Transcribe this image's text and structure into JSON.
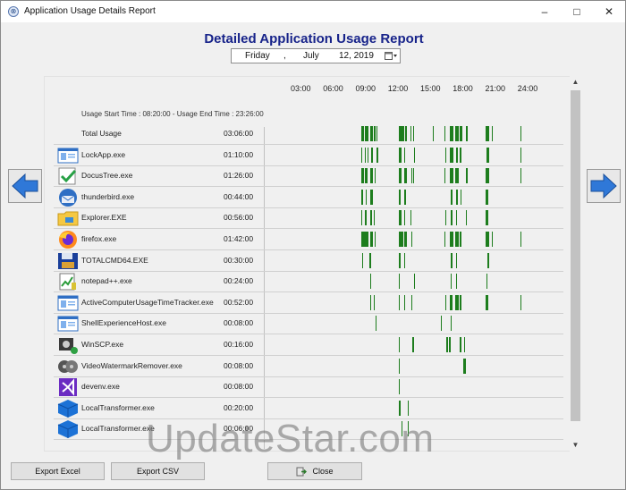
{
  "window": {
    "title": "Application Usage Details Report"
  },
  "report": {
    "title": "Detailed Application Usage Report",
    "date": {
      "weekday": "Friday",
      "sep": ",",
      "month": "July",
      "dayyear": "12, 2019"
    },
    "hours": [
      "03:00",
      "06:00",
      "09:00",
      "12:00",
      "15:00",
      "18:00",
      "21:00",
      "24:00"
    ],
    "usage_range": "Usage Start Time : 08:20:00 - Usage End Time : 23:26:00"
  },
  "colors": {
    "usage_bar": "#1d7d1d",
    "title": "#17238a",
    "nav_arrow": "#2f78d8"
  },
  "rows": [
    {
      "name": "Total Usage",
      "duration": "03:06:00",
      "icon": "none",
      "usage": [
        [
          8.6,
          0.25
        ],
        [
          8.95,
          0.3
        ],
        [
          9.4,
          0.3
        ],
        [
          9.75,
          0.15
        ],
        [
          10.0,
          0.1
        ],
        [
          12.05,
          0.5
        ],
        [
          12.65,
          0.2
        ],
        [
          13.15,
          0.1
        ],
        [
          13.4,
          0.1
        ],
        [
          15.2,
          0.15
        ],
        [
          16.3,
          0.1
        ],
        [
          16.8,
          0.35
        ],
        [
          17.3,
          0.3
        ],
        [
          17.75,
          0.2
        ],
        [
          18.3,
          0.15
        ],
        [
          20.1,
          0.35
        ],
        [
          20.7,
          0.1
        ],
        [
          23.3,
          0.1
        ]
      ]
    },
    {
      "name": "LockApp.exe",
      "duration": "01:10:00",
      "icon": "app-window-icon",
      "usage": [
        [
          8.6,
          0.1
        ],
        [
          8.95,
          0.1
        ],
        [
          9.2,
          0.1
        ],
        [
          9.55,
          0.1
        ],
        [
          10.05,
          0.1
        ],
        [
          12.05,
          0.3
        ],
        [
          12.55,
          0.1
        ],
        [
          13.45,
          0.1
        ],
        [
          16.35,
          0.1
        ],
        [
          16.8,
          0.3
        ],
        [
          17.35,
          0.2
        ],
        [
          17.75,
          0.1
        ],
        [
          20.2,
          0.25
        ],
        [
          23.3,
          0.1
        ]
      ]
    },
    {
      "name": "DocusTree.exe",
      "duration": "01:26:00",
      "icon": "checkmark-icon",
      "usage": [
        [
          8.6,
          0.25
        ],
        [
          8.95,
          0.2
        ],
        [
          9.4,
          0.3
        ],
        [
          9.85,
          0.1
        ],
        [
          12.05,
          0.3
        ],
        [
          12.6,
          0.2
        ],
        [
          13.2,
          0.1
        ],
        [
          13.4,
          0.1
        ],
        [
          16.3,
          0.1
        ],
        [
          16.8,
          0.3
        ],
        [
          17.3,
          0.3
        ],
        [
          18.3,
          0.15
        ],
        [
          20.1,
          0.3
        ],
        [
          23.3,
          0.1
        ]
      ]
    },
    {
      "name": "thunderbird.exe",
      "duration": "00:44:00",
      "icon": "thunderbird-icon",
      "usage": [
        [
          8.6,
          0.15
        ],
        [
          9.0,
          0.1
        ],
        [
          9.45,
          0.2
        ],
        [
          12.05,
          0.2
        ],
        [
          12.6,
          0.15
        ],
        [
          16.85,
          0.2
        ],
        [
          17.35,
          0.2
        ],
        [
          17.8,
          0.1
        ],
        [
          20.15,
          0.2
        ]
      ]
    },
    {
      "name": "Explorer.EXE",
      "duration": "00:56:00",
      "icon": "folder-icon",
      "usage": [
        [
          8.6,
          0.1
        ],
        [
          8.95,
          0.15
        ],
        [
          9.4,
          0.2
        ],
        [
          9.75,
          0.1
        ],
        [
          12.05,
          0.3
        ],
        [
          12.55,
          0.15
        ],
        [
          13.15,
          0.1
        ],
        [
          16.35,
          0.1
        ],
        [
          16.85,
          0.2
        ],
        [
          17.35,
          0.15
        ],
        [
          18.3,
          0.1
        ],
        [
          20.15,
          0.2
        ]
      ]
    },
    {
      "name": "firefox.exe",
      "duration": "01:42:00",
      "icon": "firefox-icon",
      "usage": [
        [
          8.6,
          0.3
        ],
        [
          8.95,
          0.35
        ],
        [
          9.4,
          0.3
        ],
        [
          9.85,
          0.1
        ],
        [
          12.05,
          0.45
        ],
        [
          12.6,
          0.2
        ],
        [
          13.2,
          0.1
        ],
        [
          16.3,
          0.1
        ],
        [
          16.8,
          0.35
        ],
        [
          17.3,
          0.3
        ],
        [
          17.75,
          0.15
        ],
        [
          20.1,
          0.35
        ],
        [
          20.7,
          0.1
        ],
        [
          23.3,
          0.1
        ]
      ]
    },
    {
      "name": "TOTALCMD64.EXE",
      "duration": "00:30:00",
      "icon": "floppy-disk-icon",
      "usage": [
        [
          8.7,
          0.1
        ],
        [
          9.35,
          0.15
        ],
        [
          12.1,
          0.15
        ],
        [
          12.55,
          0.1
        ],
        [
          16.9,
          0.15
        ],
        [
          17.35,
          0.1
        ],
        [
          20.25,
          0.15
        ]
      ]
    },
    {
      "name": "notepad++.exe",
      "duration": "00:24:00",
      "icon": "notepad-icon",
      "usage": [
        [
          9.4,
          0.1
        ],
        [
          12.05,
          0.1
        ],
        [
          13.45,
          0.1
        ],
        [
          16.9,
          0.1
        ],
        [
          17.4,
          0.1
        ],
        [
          20.2,
          0.1
        ]
      ]
    },
    {
      "name": "ActiveComputerUsageTimeTracker.exe",
      "duration": "00:52:00",
      "icon": "app-window-icon",
      "usage": [
        [
          9.4,
          0.15
        ],
        [
          9.75,
          0.1
        ],
        [
          12.05,
          0.15
        ],
        [
          12.55,
          0.1
        ],
        [
          13.2,
          0.1
        ],
        [
          16.35,
          0.1
        ],
        [
          16.8,
          0.25
        ],
        [
          17.3,
          0.3
        ],
        [
          17.75,
          0.1
        ],
        [
          20.15,
          0.25
        ],
        [
          23.3,
          0.1
        ]
      ]
    },
    {
      "name": "ShellExperienceHost.exe",
      "duration": "00:08:00",
      "icon": "app-window-icon",
      "usage": [
        [
          9.95,
          0.1
        ],
        [
          15.95,
          0.1
        ],
        [
          16.9,
          0.1
        ]
      ]
    },
    {
      "name": "WinSCP.exe",
      "duration": "00:16:00",
      "icon": "winscp-icon",
      "usage": [
        [
          12.05,
          0.1
        ],
        [
          13.35,
          0.1
        ],
        [
          16.5,
          0.1
        ],
        [
          16.75,
          0.15
        ],
        [
          17.75,
          0.1
        ],
        [
          18.1,
          0.1
        ]
      ]
    },
    {
      "name": "VideoWatermarkRemover.exe",
      "duration": "00:08:00",
      "icon": "video-reel-icon",
      "usage": [
        [
          12.05,
          0.1
        ],
        [
          18.0,
          0.1
        ],
        [
          18.15,
          0.1
        ]
      ]
    },
    {
      "name": "devenv.exe",
      "duration": "00:08:00",
      "icon": "visual-studio-icon",
      "usage": [
        [
          12.1,
          0.1
        ]
      ]
    },
    {
      "name": "LocalTransformer.exe",
      "duration": "00:20:00",
      "icon": "cube-icon",
      "usage": [
        [
          12.1,
          0.15
        ],
        [
          12.9,
          0.1
        ]
      ]
    },
    {
      "name": "LocalTransformer.exe",
      "duration": "00:06:00",
      "icon": "cube-icon",
      "usage": [
        [
          12.3,
          0.1
        ],
        [
          12.9,
          0.1
        ]
      ]
    }
  ],
  "buttons": {
    "export_excel": "Export Excel",
    "export_csv": "Export CSV",
    "close": "Close"
  },
  "watermark": "UpdateStar.com"
}
